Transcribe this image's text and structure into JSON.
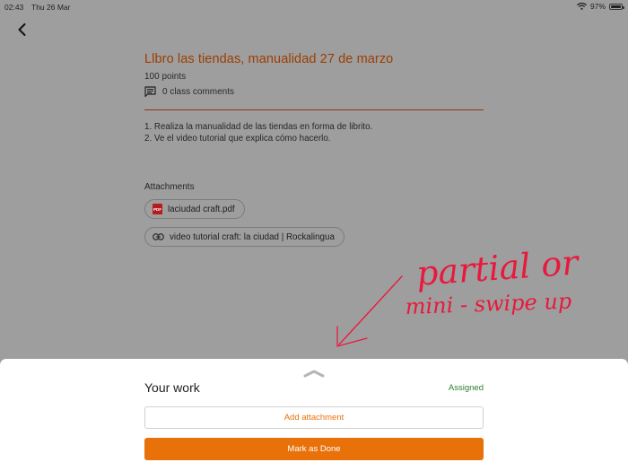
{
  "status_bar": {
    "time": "02:43",
    "date": "Thu 26 Mar",
    "battery": "97%",
    "battery_level": 0.97,
    "icons": [
      "wifi-icon",
      "battery-icon"
    ]
  },
  "header": {
    "back_icon": "chevron-left-icon"
  },
  "assignment": {
    "title": "Llbro las tiendas, manualidad 27 de marzo",
    "points": "100 points",
    "comments": "0 class comments",
    "instructions": [
      "1. Realiza la manualidad de las tiendas en forma de librito.",
      "2. Ve el video tutorial que explica cómo hacerlo."
    ],
    "attachments_label": "Attachments",
    "attachments": [
      {
        "label": "laciudad craft.pdf",
        "icon": "pdf-icon",
        "icon_text": "PDF"
      },
      {
        "label": "video tutorial craft: la ciudad | Rockalingua",
        "icon": "link-icon"
      }
    ]
  },
  "annotation": {
    "line1": "partial or",
    "line2": "mini - swipe up",
    "color": "#e8193c"
  },
  "your_work": {
    "title": "Your work",
    "status": "Assigned",
    "add_attachment": "Add attachment",
    "mark_done": "Mark as Done"
  },
  "colors": {
    "accent": "#e8710a",
    "title": "#9c3d00",
    "status_green": "#2e7d32",
    "overlay_bg": "#9e9e9e"
  }
}
